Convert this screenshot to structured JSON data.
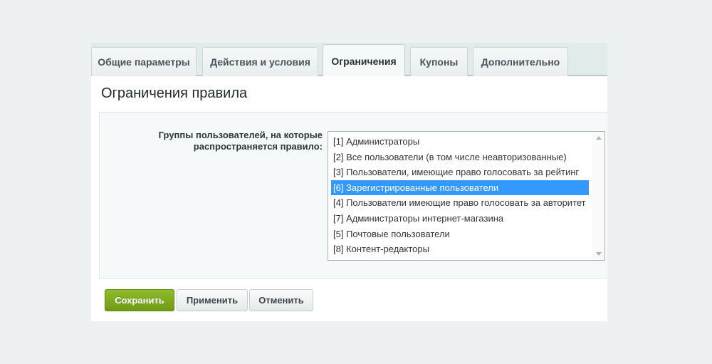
{
  "tabs": [
    {
      "label": "Общие параметры",
      "active": false
    },
    {
      "label": "Действия и условия",
      "active": false
    },
    {
      "label": "Ограничения",
      "active": true
    },
    {
      "label": "Купоны",
      "active": false
    },
    {
      "label": "Дополнительно",
      "active": false
    }
  ],
  "section": {
    "title": "Ограничения правила"
  },
  "form": {
    "field_label": "Группы пользователей, на которые распространяется правило:",
    "options": [
      {
        "text": "[1] Администраторы",
        "selected": false
      },
      {
        "text": "[2] Все пользователи (в том числе неавторизованные)",
        "selected": false
      },
      {
        "text": "[3] Пользователи, имеющие право голосовать за рейтинг",
        "selected": false
      },
      {
        "text": "[6] Зарегистрированные пользователи",
        "selected": true
      },
      {
        "text": "[4] Пользователи имеющие право голосовать за авторитет",
        "selected": false
      },
      {
        "text": "[7] Администраторы интернет-магазина",
        "selected": false
      },
      {
        "text": "[5] Почтовые пользователи",
        "selected": false
      },
      {
        "text": "[8] Контент-редакторы",
        "selected": false
      }
    ]
  },
  "buttons": {
    "save": "Сохранить",
    "apply": "Применить",
    "cancel": "Отменить"
  },
  "colors": {
    "accent_green": "#7aa81f",
    "selection_blue": "#3399ff"
  }
}
